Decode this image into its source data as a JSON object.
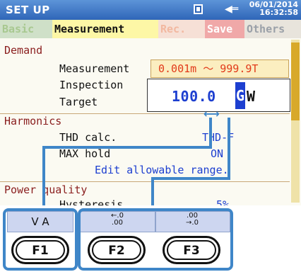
{
  "header": {
    "title": "SET UP",
    "date": "06/01/2014",
    "time": "16:32:58"
  },
  "tabs": [
    {
      "label": "Basic"
    },
    {
      "label": "Measurement"
    },
    {
      "label": "Rec."
    },
    {
      "label": "Save"
    },
    {
      "label": "Others"
    }
  ],
  "demand": {
    "section": "Demand",
    "measurement_label": "Measurement",
    "range": "0.001m ～ 999.9T",
    "inspection_label": "Inspection",
    "target_label": "Target",
    "target_value": "100.0",
    "target_cursor_digit": "G",
    "target_unit": "W"
  },
  "harmonics": {
    "section": "Harmonics",
    "thd_label": "THD calc.",
    "thd_value": "THD-F",
    "max_hold_label": "MAX hold",
    "max_hold_value": "ON",
    "hint": "Edit allowable range."
  },
  "power_quality": {
    "section": "Power quality",
    "hysteresis_label": "Hysteresis",
    "hysteresis_value": "5%"
  },
  "softkeys": [
    {
      "label": "V A",
      "button": "F1"
    },
    {
      "label": "",
      "icon_top": "←.0",
      "icon_bottom": ".00",
      "button": "F2"
    },
    {
      "label": "",
      "icon_top": ".00",
      "icon_bottom": "→.0",
      "button": "F3"
    }
  ],
  "colors": {
    "accent": "#3f86c8",
    "value": "#1d3fd0",
    "range": "#e23a1a",
    "section": "#8a1e1e"
  }
}
